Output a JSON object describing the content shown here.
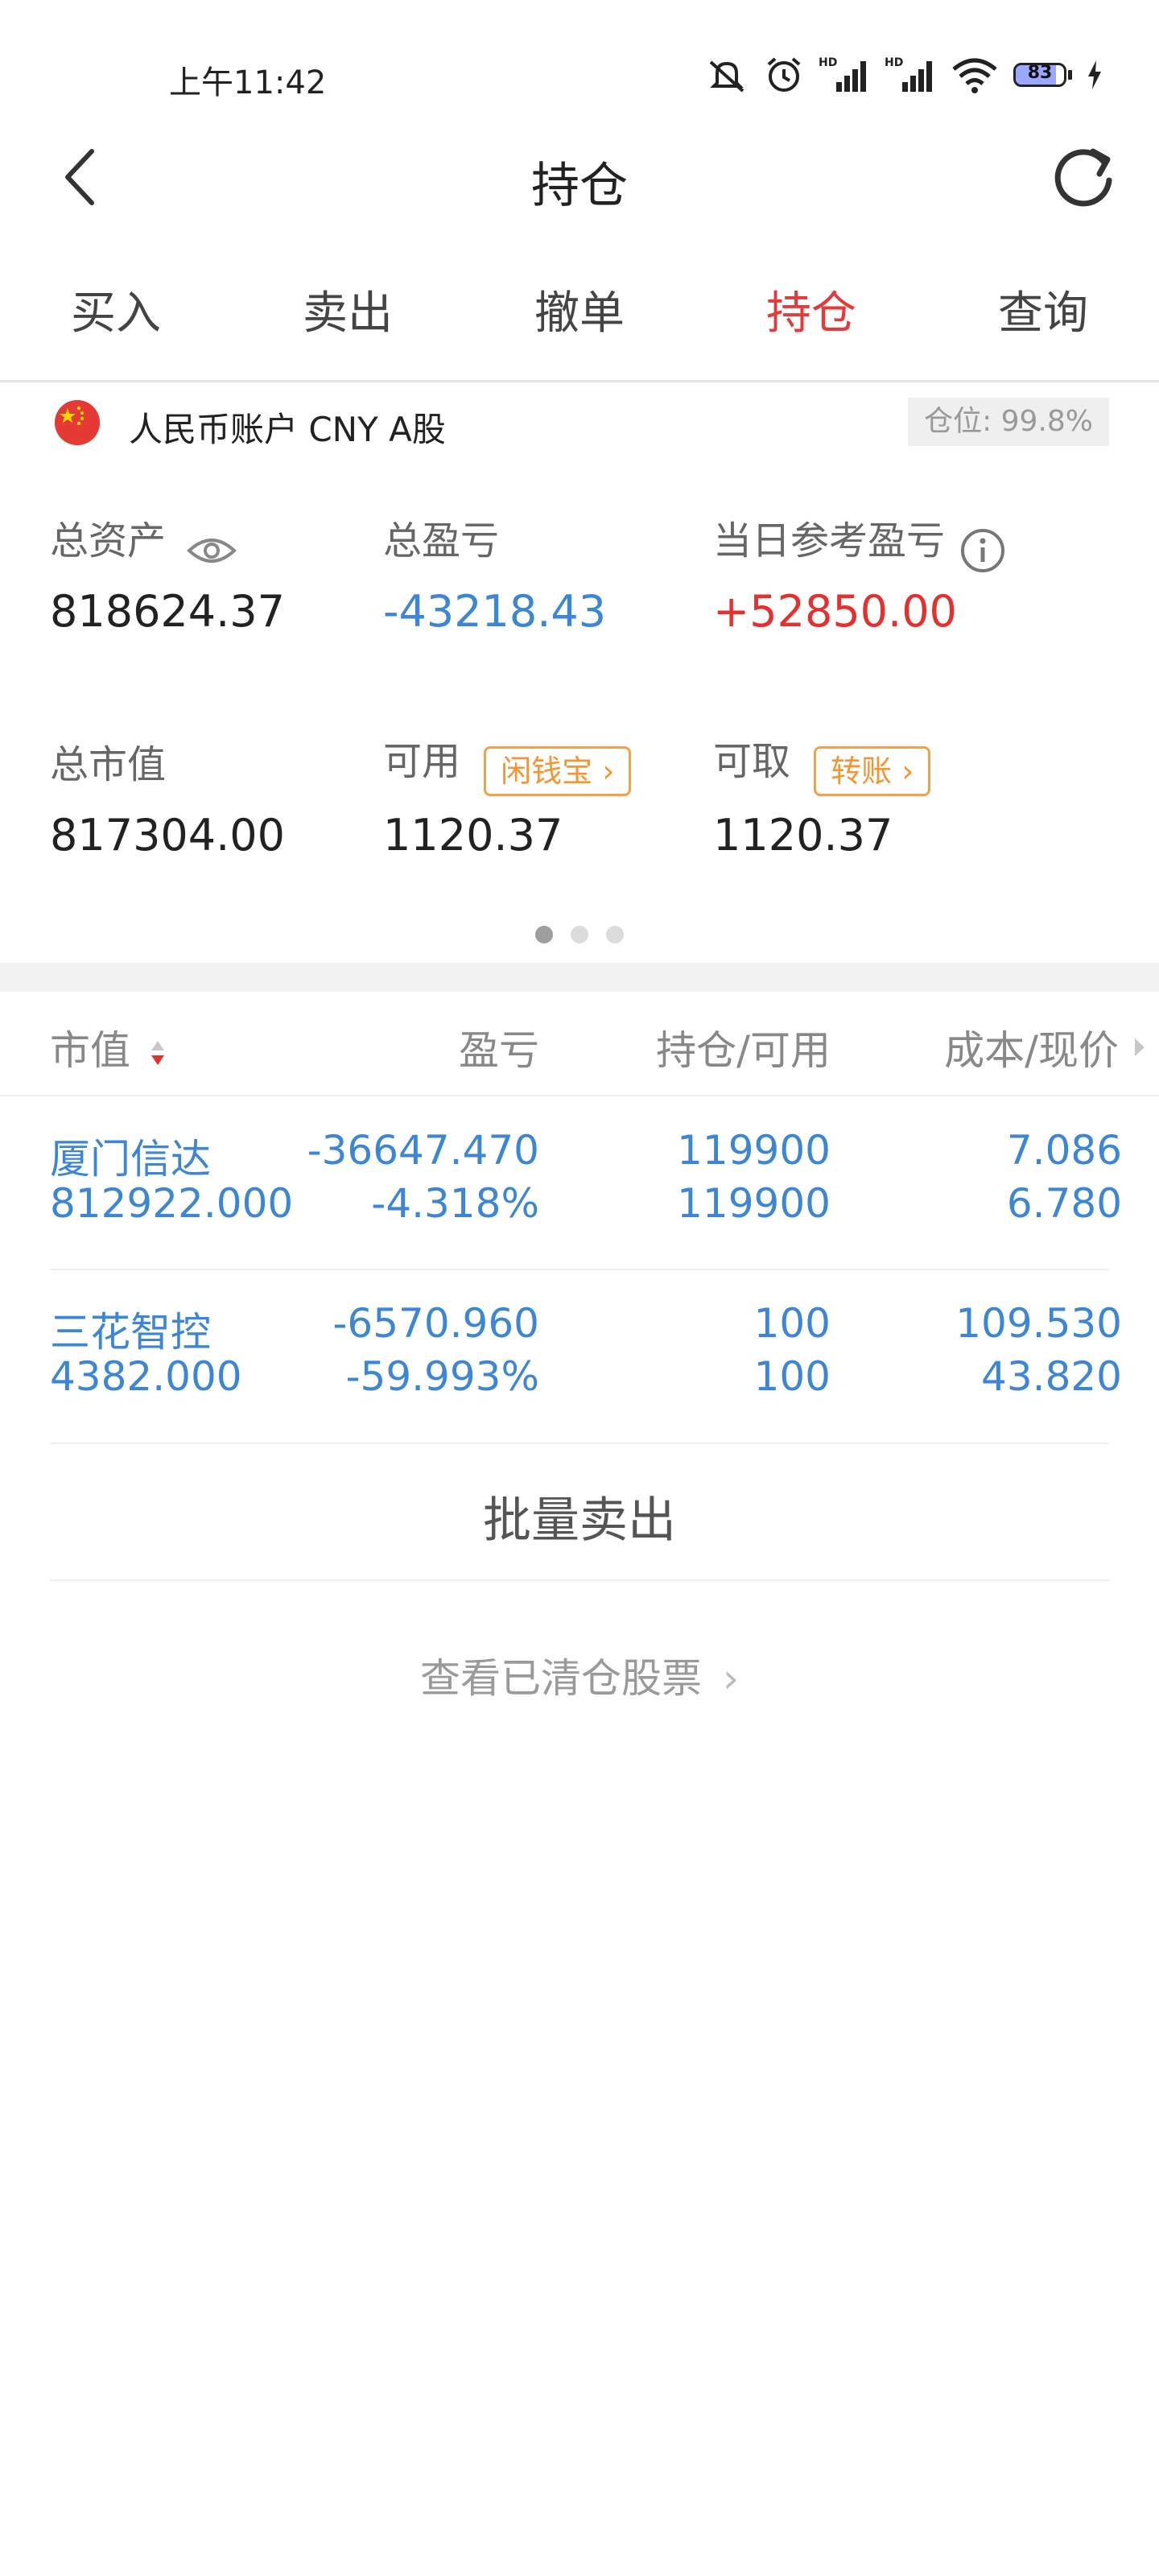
{
  "status_bar": {
    "time": "上午11:42",
    "battery_level": "83",
    "battery_color": "#9aa9ff"
  },
  "header": {
    "title": "持仓",
    "back_icon": "chevron-left-icon",
    "refresh_icon": "refresh-icon"
  },
  "tabs": [
    {
      "label": "买入",
      "active": false
    },
    {
      "label": "卖出",
      "active": false
    },
    {
      "label": "撤单",
      "active": false
    },
    {
      "label": "持仓",
      "active": true
    },
    {
      "label": "查询",
      "active": false
    }
  ],
  "account": {
    "label": "人民币账户 CNY A股",
    "position": "仓位: 99.8%"
  },
  "assets": {
    "total_assets_label": "总资产",
    "total_assets_value": "818624.37",
    "total_pnl_label": "总盈亏",
    "total_pnl_value": "-43218.43",
    "daily_pnl_label": "当日参考盈亏",
    "daily_pnl_value": "+52850.00",
    "market_value_label": "总市值",
    "market_value_value": "817304.00",
    "available_label": "可用",
    "available_value": "1120.37",
    "available_button": "闲钱宝",
    "withdrawable_label": "可取",
    "withdrawable_value": "1120.37",
    "withdrawable_button": "转账"
  },
  "pager": {
    "count": 3,
    "active": 0
  },
  "table": {
    "headers": [
      "市值",
      "盈亏",
      "持仓/可用",
      "成本/现价"
    ],
    "rows": [
      {
        "name": "厦门信达",
        "market_value": "812922.000",
        "pnl": "-36647.470",
        "pnl_pct": "-4.318%",
        "position": "119900",
        "available": "119900",
        "cost": "7.086",
        "price": "6.780"
      },
      {
        "name": "三花智控",
        "market_value": "4382.000",
        "pnl": "-6570.960",
        "pnl_pct": "-59.993%",
        "position": "100",
        "available": "100",
        "cost": "109.530",
        "price": "43.820"
      }
    ]
  },
  "actions": {
    "batch_sell": "批量卖出",
    "view_cleared": "查看已清仓股票"
  },
  "colors": {
    "accent_red": "#e33b3b",
    "value_blue": "#3d86d6",
    "pill_orange": "#f39533"
  }
}
